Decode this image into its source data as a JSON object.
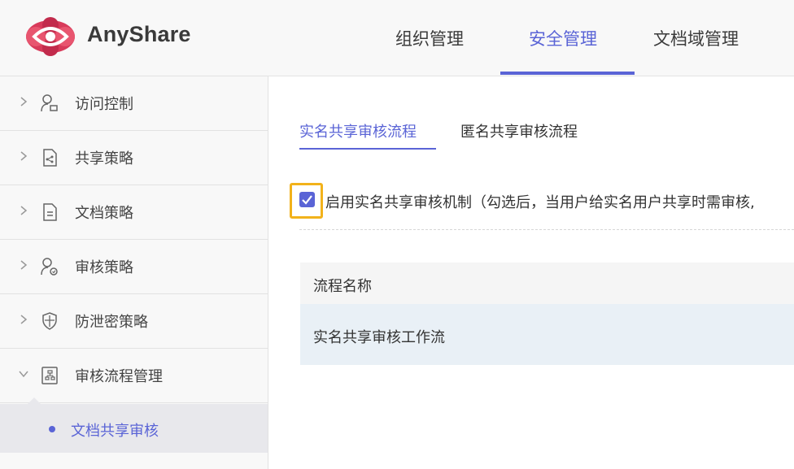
{
  "header": {
    "brand": "AnyShare",
    "tabs": [
      {
        "label": "组织管理",
        "active": false
      },
      {
        "label": "安全管理",
        "active": true
      },
      {
        "label": "文档域管理",
        "active": false
      }
    ],
    "accent_color": "#5a64d6"
  },
  "sidebar": {
    "items": [
      {
        "label": "访问控制",
        "icon": "user-key-icon"
      },
      {
        "label": "共享策略",
        "icon": "share-doc-icon"
      },
      {
        "label": "文档策略",
        "icon": "document-icon"
      },
      {
        "label": "审核策略",
        "icon": "user-audit-icon"
      },
      {
        "label": "防泄密策略",
        "icon": "shield-icon"
      },
      {
        "label": "审核流程管理",
        "icon": "flow-doc-icon",
        "expanded": true
      }
    ],
    "sub_items": [
      {
        "label": "文档共享审核",
        "active": true
      }
    ]
  },
  "main": {
    "tabs": [
      {
        "label": "实名共享审核流程",
        "active": true
      },
      {
        "label": "匿名共享审核流程",
        "active": false
      }
    ],
    "enable_checkbox": {
      "checked": true,
      "label": "启用实名共享审核机制（勾选后，当用户给实名用户共享时需审核,"
    },
    "table": {
      "columns": [
        "流程名称"
      ],
      "rows": [
        [
          "实名共享审核工作流"
        ]
      ]
    }
  }
}
